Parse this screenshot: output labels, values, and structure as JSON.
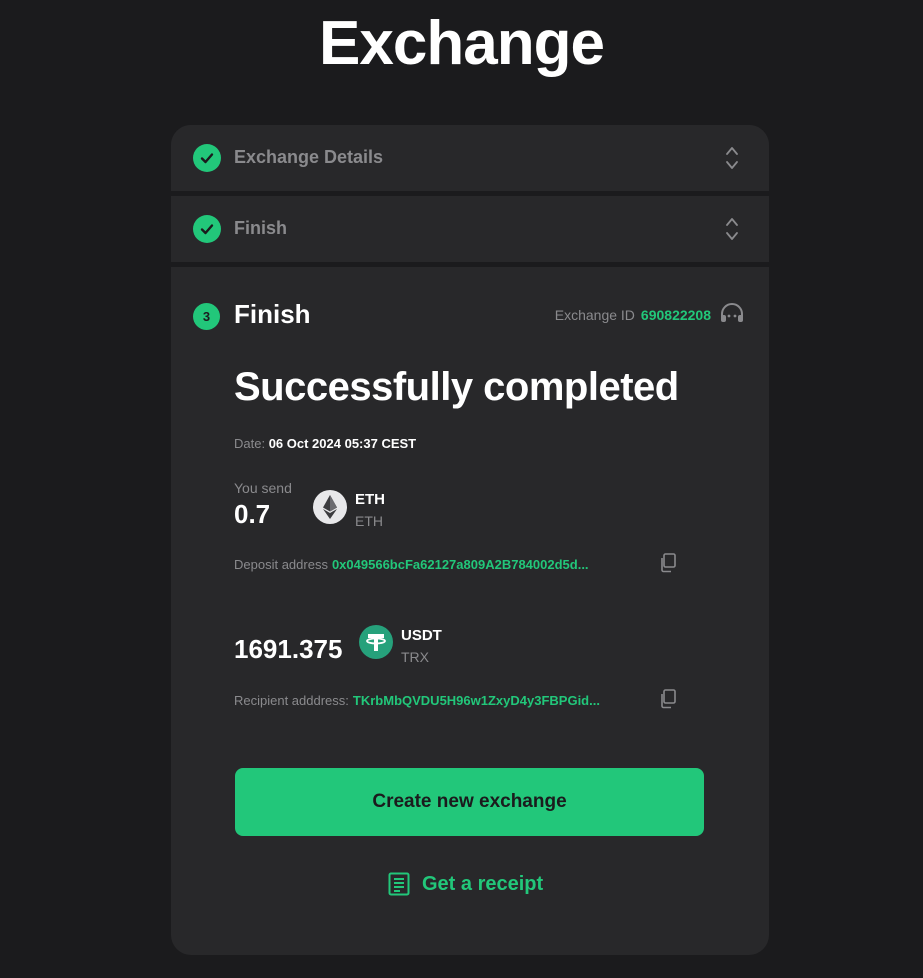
{
  "page": {
    "title": "Exchange"
  },
  "steps": [
    {
      "label": "Exchange Details"
    },
    {
      "label": "Finish"
    }
  ],
  "current_step": {
    "number": "3",
    "title": "Finish",
    "exchange_id_label": "Exchange ID",
    "exchange_id": "690822208"
  },
  "result": {
    "headline": "Successfully completed",
    "date_label": "Date:",
    "date_value": "06 Oct 2024 05:37 CEST"
  },
  "send": {
    "label": "You send",
    "amount": "0.7",
    "ticker": "ETH",
    "network": "ETH",
    "icon": "ethereum-icon",
    "address_label": "Deposit address",
    "address": "0x049566bcFa62127a809A2B784002d5d..."
  },
  "receive": {
    "amount": "1691.375",
    "ticker": "USDT",
    "network": "TRX",
    "icon": "tether-icon",
    "address_label": "Recipient adddress:",
    "address": "TKrbMbQVDU5H96w1ZxyD4y3FBPGid..."
  },
  "actions": {
    "create_label": "Create new exchange",
    "receipt_label": "Get a receipt"
  },
  "colors": {
    "accent": "#22c77a",
    "background": "#1b1b1d",
    "card": "#28282a",
    "muted": "#8a8a8d"
  }
}
